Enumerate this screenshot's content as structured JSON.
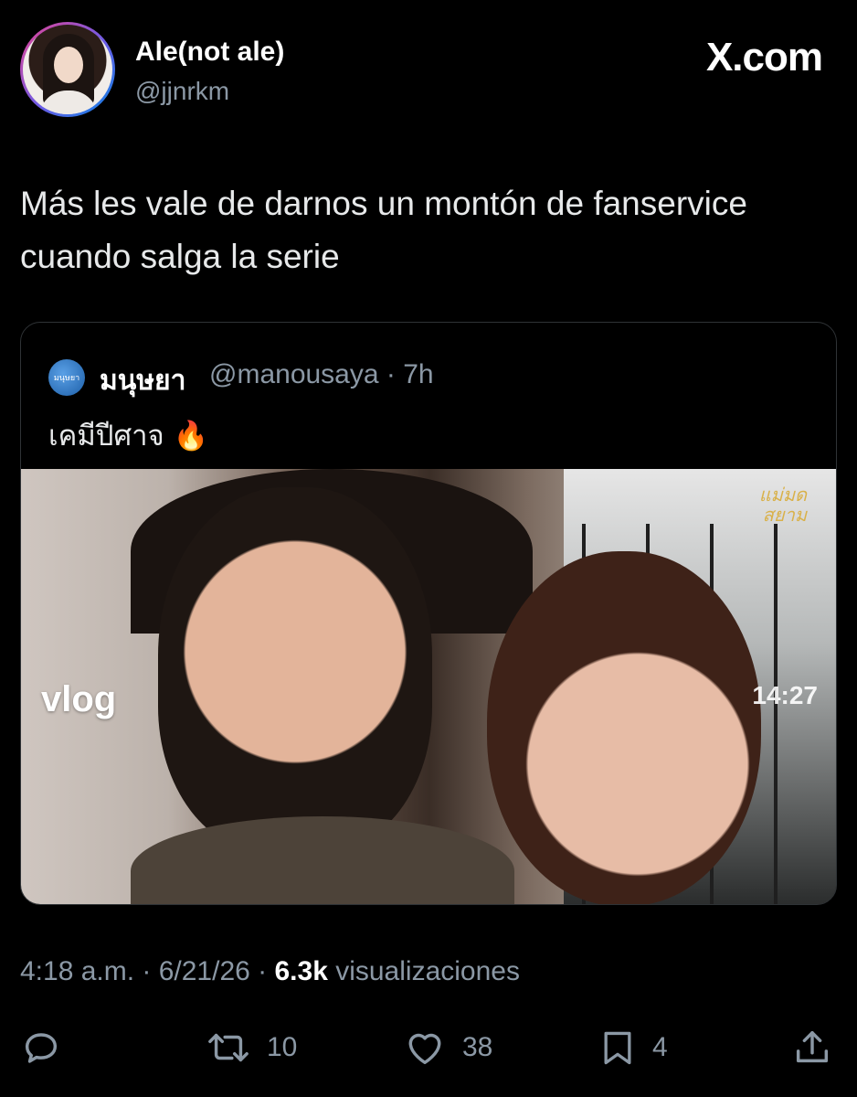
{
  "header": {
    "display_name": "Ale(not ale)",
    "handle": "@jjnrkm",
    "brand": "X.com"
  },
  "tweet": {
    "text": "Más les vale de darnos un montón de fanservice cuando salga la serie"
  },
  "quoted_tweet": {
    "avatar_text": "มนุษยา",
    "name": "มนุษยา",
    "handle_time": "@manousaya · 7h",
    "text": "เคมีปีศาจ 🔥",
    "media": {
      "overlay_left": "vlog",
      "overlay_right": "14:27",
      "watermark": "แม่มดสยาม"
    }
  },
  "meta": {
    "time": "4:18 a.m. · 6/21/26 · ",
    "views_count": "6.3k",
    "views_label": " visualizaciones"
  },
  "actions": {
    "reply_icon": "reply-icon",
    "retweets": "10",
    "likes": "38",
    "bookmarks": "4",
    "share_icon": "share-icon"
  },
  "colors": {
    "background": "#000000",
    "text": "#e7e9ea",
    "secondary": "#8b98a5",
    "border": "#2f3336"
  }
}
